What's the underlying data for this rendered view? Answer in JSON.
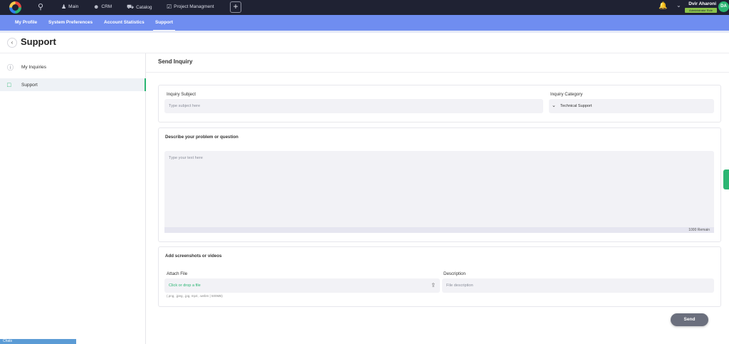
{
  "topbar": {
    "items": [
      {
        "label": "Main",
        "icon": "user-icon"
      },
      {
        "label": "CRM",
        "icon": "people-icon"
      },
      {
        "label": "Catalog",
        "icon": "truck-icon"
      },
      {
        "label": "Project Managment",
        "icon": "checkbox-icon"
      }
    ],
    "plus": "+",
    "user_name": "Dvir Aharoni",
    "user_role": "Administrator Role",
    "avatar_initials": "DA"
  },
  "subnav": {
    "tabs": [
      "My Profile",
      "System Preferences",
      "Account Statistics",
      "Support"
    ],
    "active": "Support"
  },
  "page": {
    "back": "‹",
    "title": "Support"
  },
  "sidebar": {
    "items": [
      {
        "label": "My Inquiries",
        "icon": "question-circle-icon"
      },
      {
        "label": "Support",
        "icon": "chat-bubble-icon"
      }
    ],
    "chats": "Chats"
  },
  "main": {
    "title": "Send Inquiry",
    "subject_label": "Inquiry Subject",
    "subject_placeholder": "Type subject here",
    "category_label": "Inquiry Category",
    "category_value": "Technical Support",
    "describe_label": "Describe your problem or question",
    "text_placeholder": "Type your text here",
    "counter": "1000 Remain",
    "media_label": "Add screenshots or videos",
    "attach_label": "Attach File",
    "attach_placeholder": "Click or drop a file",
    "attach_hint": "(.png, .jpeg, .jpg, mp4, .webm | 500MB)",
    "desc_label": "Description",
    "desc_placeholder": "File description",
    "send": "Send"
  },
  "colors": {
    "topbar": "#1f2233",
    "subnav": "#6f8df0",
    "accent": "#2bb673",
    "send": "#6b6f7d"
  }
}
